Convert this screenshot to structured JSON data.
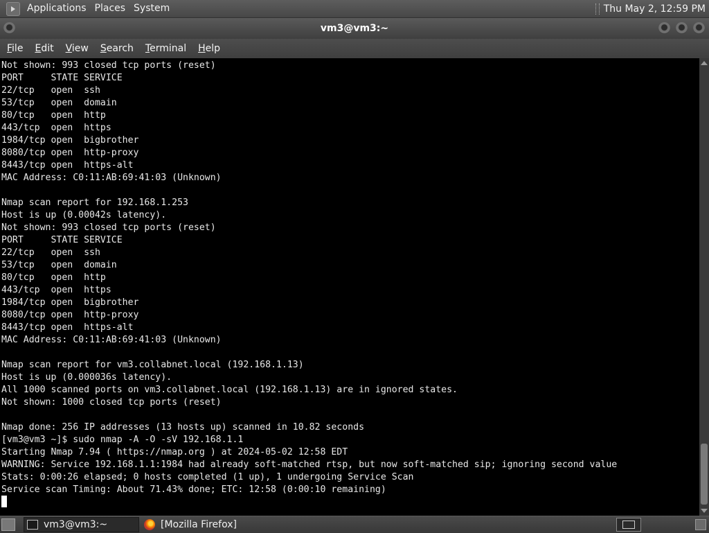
{
  "top_panel": {
    "menus": [
      "Applications",
      "Places",
      "System"
    ],
    "clock": "Thu May 2, 12:59 PM",
    "logo_icon": "gnome-foot-icon"
  },
  "window": {
    "title": "vm3@vm3:~",
    "buttons": [
      "window-menu",
      "minimize",
      "maximize",
      "close"
    ]
  },
  "menu_bar": {
    "items": [
      {
        "label": "File",
        "accel": "F",
        "rest": "ile"
      },
      {
        "label": "Edit",
        "accel": "E",
        "rest": "dit"
      },
      {
        "label": "View",
        "accel": "V",
        "rest": "iew"
      },
      {
        "label": "Search",
        "accel": "S",
        "rest": "earch"
      },
      {
        "label": "Terminal",
        "accel": "T",
        "rest": "erminal"
      },
      {
        "label": "Help",
        "accel": "H",
        "rest": "elp"
      }
    ]
  },
  "terminal": {
    "lines": [
      "Not shown: 993 closed tcp ports (reset)",
      "PORT     STATE SERVICE",
      "22/tcp   open  ssh",
      "53/tcp   open  domain",
      "80/tcp   open  http",
      "443/tcp  open  https",
      "1984/tcp open  bigbrother",
      "8080/tcp open  http-proxy",
      "8443/tcp open  https-alt",
      "MAC Address: C0:11:AB:69:41:03 (Unknown)",
      "",
      "Nmap scan report for 192.168.1.253",
      "Host is up (0.00042s latency).",
      "Not shown: 993 closed tcp ports (reset)",
      "PORT     STATE SERVICE",
      "22/tcp   open  ssh",
      "53/tcp   open  domain",
      "80/tcp   open  http",
      "443/tcp  open  https",
      "1984/tcp open  bigbrother",
      "8080/tcp open  http-proxy",
      "8443/tcp open  https-alt",
      "MAC Address: C0:11:AB:69:41:03 (Unknown)",
      "",
      "Nmap scan report for vm3.collabnet.local (192.168.1.13)",
      "Host is up (0.000036s latency).",
      "All 1000 scanned ports on vm3.collabnet.local (192.168.1.13) are in ignored states.",
      "Not shown: 1000 closed tcp ports (reset)",
      "",
      "Nmap done: 256 IP addresses (13 hosts up) scanned in 10.82 seconds",
      "[vm3@vm3 ~]$ sudo nmap -A -O -sV 192.168.1.1",
      "Starting Nmap 7.94 ( https://nmap.org ) at 2024-05-02 12:58 EDT",
      "WARNING: Service 192.168.1.1:1984 had already soft-matched rtsp, but now soft-matched sip; ignoring second value",
      "Stats: 0:00:26 elapsed; 0 hosts completed (1 up), 1 undergoing Service Scan",
      "Service scan Timing: About 71.43% done; ETC: 12:58 (0:00:10 remaining)"
    ]
  },
  "taskbar": {
    "tasks": [
      {
        "label": "vm3@vm3:~",
        "icon": "terminal-icon",
        "active": true
      },
      {
        "label": "[Mozilla Firefox]",
        "icon": "firefox-icon",
        "active": false
      }
    ]
  },
  "colors": {
    "terminal_bg": "#000000",
    "terminal_fg": "#e8e8e8",
    "panel_bg": "#4f4f4f"
  }
}
